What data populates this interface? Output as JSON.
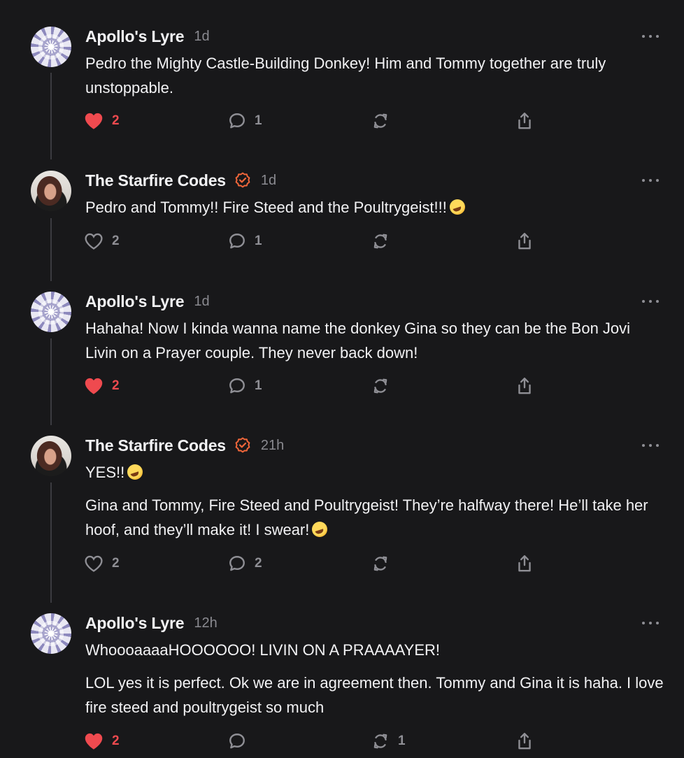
{
  "posts": [
    {
      "author": "Apollo's Lyre",
      "verified": false,
      "time": "1d",
      "paragraphs": [
        "Pedro the Mighty Castle-Building Donkey! Him and Tommy together are truly unstoppable."
      ],
      "likes": "2",
      "liked": true,
      "replies": "1",
      "reposts": ""
    },
    {
      "author": "The Starfire Codes",
      "verified": true,
      "time": "1d",
      "paragraphs": [
        "Pedro and Tommy!! Fire Steed and the Poultrygeist!!!"
      ],
      "likes": "2",
      "liked": false,
      "replies": "1",
      "reposts": ""
    },
    {
      "author": "Apollo's Lyre",
      "verified": false,
      "time": "1d",
      "paragraphs": [
        "Hahaha! Now I kinda wanna name the donkey Gina so they can be the Bon Jovi Livin on a Prayer couple. They never back down!"
      ],
      "likes": "2",
      "liked": true,
      "replies": "1",
      "reposts": ""
    },
    {
      "author": "The Starfire Codes",
      "verified": true,
      "time": "21h",
      "paragraphs": [
        "YES!!",
        "Gina and Tommy, Fire Steed and Poultrygeist! They’re halfway there! He’ll take her hoof, and they’ll make it! I swear!"
      ],
      "likes": "2",
      "liked": false,
      "replies": "2",
      "reposts": ""
    },
    {
      "author": "Apollo's Lyre",
      "verified": false,
      "time": "12h",
      "paragraphs": [
        "WhoooaaaaHOOOOOO! LIVIN ON A PRAAAAYER!",
        "LOL yes it is perfect. Ok we are in agreement then. Tommy and Gina it is haha. I love fire steed and poultrygeist so much"
      ],
      "likes": "2",
      "liked": true,
      "replies": "",
      "reposts": "1"
    }
  ],
  "colors": {
    "like": "#ef4a4f",
    "verified": "#f0663a",
    "muted": "#8f8f95",
    "background": "#18181a"
  }
}
